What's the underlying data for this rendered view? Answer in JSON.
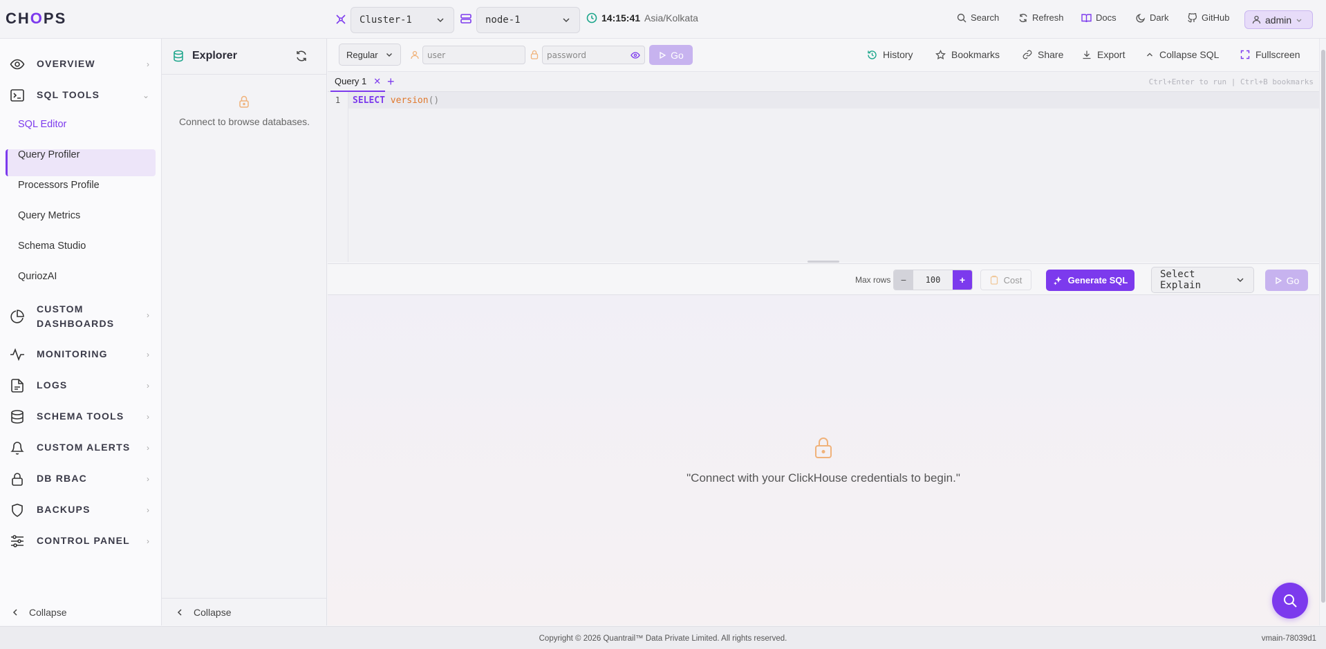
{
  "header": {
    "logo": "CHOPS",
    "cluster": "Cluster-1",
    "node": "node-1",
    "time": "14:15:41",
    "timezone": "Asia/Kolkata",
    "links": [
      "Search",
      "Refresh",
      "Docs",
      "Dark",
      "GitHub"
    ],
    "user": "admin"
  },
  "sidebar": {
    "sections": [
      {
        "label": "OVERVIEW",
        "icon": "eye-icon"
      },
      {
        "label": "SQL TOOLS",
        "icon": "terminal-icon"
      },
      {
        "label": "CUSTOM DASHBOARDS",
        "icon": "pie-chart-icon"
      },
      {
        "label": "MONITORING",
        "icon": "activity-icon"
      },
      {
        "label": "LOGS",
        "icon": "file-icon"
      },
      {
        "label": "SCHEMA TOOLS",
        "icon": "database-icon"
      },
      {
        "label": "CUSTOM ALERTS",
        "icon": "bell-icon"
      },
      {
        "label": "DB RBAC",
        "icon": "lock-icon"
      },
      {
        "label": "BACKUPS",
        "icon": "shield-icon"
      },
      {
        "label": "CONTROL PANEL",
        "icon": "sliders-icon"
      }
    ],
    "sql_tools_items": [
      "SQL Editor",
      "Query Profiler",
      "Processors Profile",
      "Query Metrics",
      "Schema Studio",
      "QuriozAI"
    ],
    "active_item": "SQL Editor",
    "collapse": "Collapse"
  },
  "explorer": {
    "title": "Explorer",
    "message": "Connect to browse databases.",
    "collapse": "Collapse"
  },
  "toolbar": {
    "mode": "Regular",
    "user_placeholder": "user",
    "password_placeholder": "password",
    "go": "Go",
    "history": "History",
    "bookmarks": "Bookmarks",
    "share": "Share",
    "export": "Export",
    "collapse_sql": "Collapse SQL",
    "fullscreen": "Fullscreen"
  },
  "tabs": {
    "items": [
      {
        "label": "Query 1"
      }
    ],
    "shortcut_hint": "Ctrl+Enter to run | Ctrl+B bookmarks"
  },
  "editor": {
    "line_number": "1",
    "keyword": "SELECT",
    "function": "version",
    "parens": "()"
  },
  "runbar": {
    "maxrows_label": "Max rows",
    "maxrows_value": "100",
    "minus": "−",
    "plus": "+",
    "cost": "Cost",
    "generate": "Generate SQL",
    "explain": "Select Explain",
    "go": "Go"
  },
  "results": {
    "message": "\"Connect with your ClickHouse credentials to begin.\""
  },
  "footer": {
    "copyright": "Copyright © 2026 Quantrail™ Data Private Limited. All rights reserved.",
    "version": "vmain-78039d1"
  },
  "colors": {
    "accent": "#7c3aed",
    "accent_light": "#ede5f9",
    "lock_orange": "#f0b27a"
  }
}
